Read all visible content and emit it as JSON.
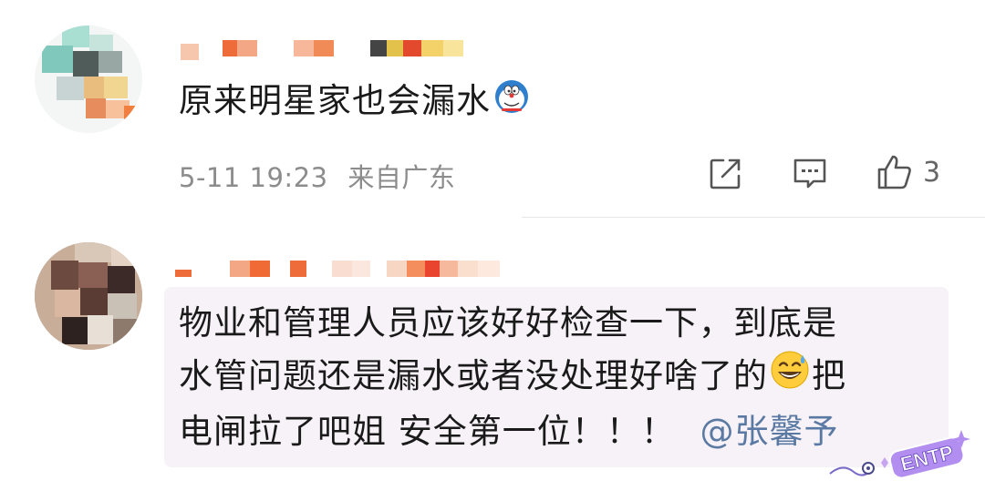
{
  "comments": [
    {
      "body": "原来明星家也会漏水",
      "emoji_icon": "doraemon-emoji",
      "time": "5-11 19:23",
      "location": "来自广东",
      "like_count": "3"
    },
    {
      "body_line1": "物业和管理人员应该好好检查一下，到底是",
      "body_line2": "水管问题还是漏水或者没处理好啥了的",
      "body_line2_after": "把",
      "body_line3": "电闸拉了吧姐 安全第一位！！！",
      "mention": "@张馨予",
      "emoji_icon": "sweat-smile-emoji"
    }
  ],
  "watermark": {
    "text": "ENTP"
  },
  "colors": {
    "text": "#1a1a1a",
    "meta": "#8c8c8c",
    "mention": "#5b7aa3",
    "bubble": "#f6f2f7"
  }
}
